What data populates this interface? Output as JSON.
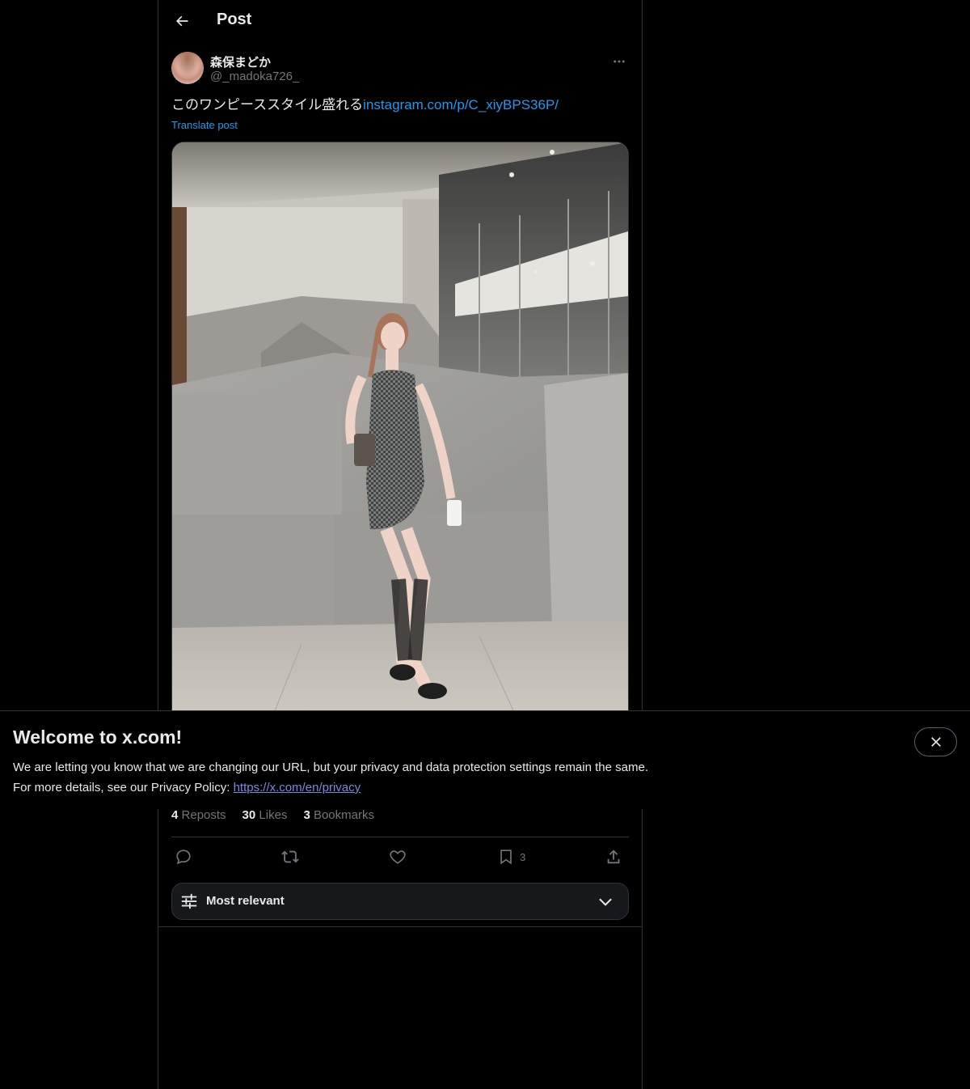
{
  "header": {
    "title": "Post",
    "back_icon": "arrow-left-icon"
  },
  "post": {
    "author": {
      "display_name": "森保まどか",
      "handle": "@_madoka726_"
    },
    "text": "このワンピーススタイル盛れる",
    "link_text": "instagram.com/p/C_xiyBPS36P/",
    "translate_label": "Translate post",
    "stats": {
      "reposts_count": "4",
      "reposts_label": "Reposts",
      "likes_count": "30",
      "likes_label": "Likes",
      "bookmarks_count": "3",
      "bookmarks_label": "Bookmarks"
    },
    "actions": {
      "reply_icon": "reply-icon",
      "repost_icon": "repost-icon",
      "like_icon": "heart-icon",
      "bookmark_icon": "bookmark-icon",
      "bookmark_count": "3",
      "share_icon": "share-icon"
    }
  },
  "sort": {
    "label": "Most relevant",
    "icon": "sliders-icon"
  },
  "banner": {
    "title": "Welcome to x.com!",
    "line1": "We are letting you know that we are changing our URL, but your privacy and data protection settings remain the same.",
    "line2_prefix": "For more details, see our Privacy Policy: ",
    "privacy_link": "https://x.com/en/privacy",
    "close_icon": "close-icon"
  },
  "colors": {
    "background": "#000000",
    "text": "#e7e9ea",
    "muted": "#71767b",
    "accent": "#1d9bf0",
    "border": "#2f3336"
  }
}
